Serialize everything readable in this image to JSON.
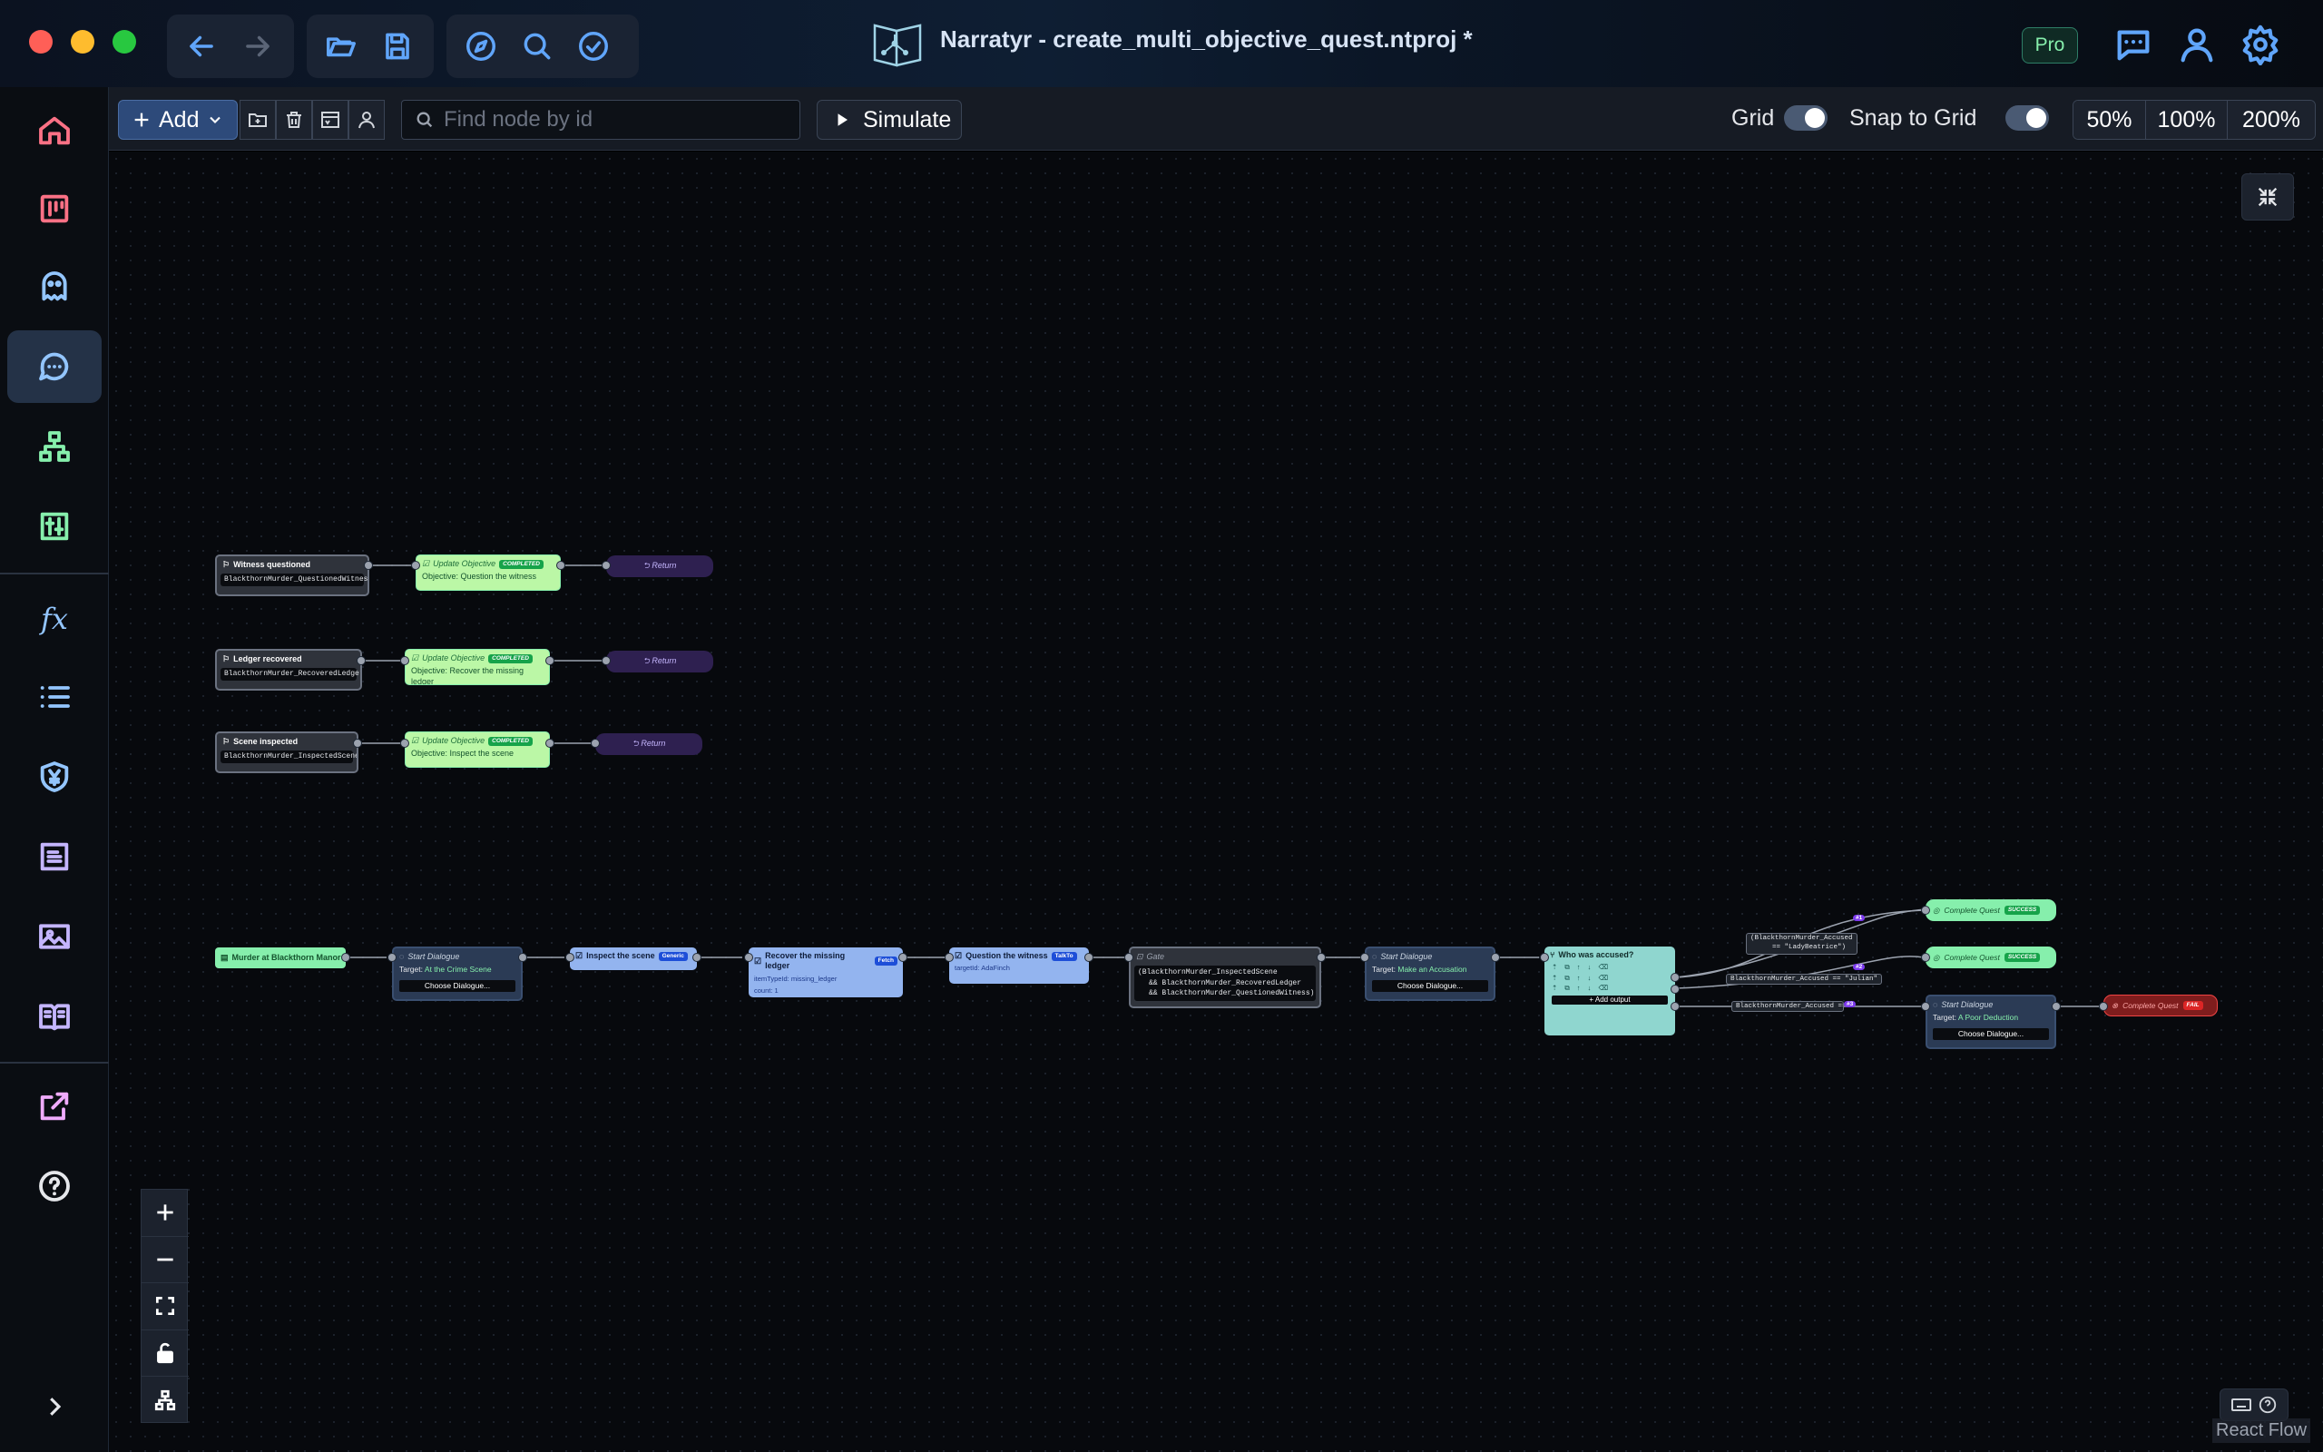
{
  "window": {
    "title": "Narratyr - create_multi_objective_quest.ntproj *",
    "pro_badge": "Pro"
  },
  "toolbar": {
    "add_label": "Add",
    "search_placeholder": "Find node by id",
    "simulate_label": "Simulate",
    "grid_label": "Grid",
    "snap_label": "Snap to Grid",
    "grid_on": true,
    "snap_on": true,
    "zoom_levels": [
      "50%",
      "100%",
      "200%"
    ]
  },
  "sidebar": {
    "items": [
      "home-icon",
      "board-icon",
      "ghost-icon",
      "chat-icon",
      "hierarchy-icon",
      "sliders-icon",
      "function-icon",
      "list-icon",
      "currency-icon",
      "document-icon",
      "image-icon",
      "book-icon",
      "export-icon",
      "help-icon"
    ],
    "fx_label": "fx"
  },
  "graph": {
    "flag_nodes": [
      {
        "title": "Witness questioned",
        "code": "BlackthornMurder_QuestionedWitness"
      },
      {
        "title": "Ledger recovered",
        "code": "BlackthornMurder_RecoveredLedger"
      },
      {
        "title": "Scene inspected",
        "code": "BlackthornMurder_InspectedScene"
      }
    ],
    "update_nodes": [
      {
        "title": "Update Objective",
        "badge": "COMPLETED",
        "body": "Objective: Question the witness"
      },
      {
        "title": "Update Objective",
        "badge": "COMPLETED",
        "body": "Objective: Recover the missing ledger"
      },
      {
        "title": "Update Objective",
        "badge": "COMPLETED",
        "body": "Objective: Inspect the scene"
      }
    ],
    "return_label": "Return",
    "entry": "Murder at Blackthorn Manor",
    "dialogue1": {
      "title": "Start Dialogue",
      "target_label": "Target:",
      "target": "At the Crime Scene",
      "choose": "Choose Dialogue..."
    },
    "obj_inspect": {
      "title": "Inspect the scene",
      "badge": "Generic"
    },
    "obj_ledger": {
      "title": "Recover the missing ledger",
      "badge": "Fetch",
      "line1_label": "itemTypeId:",
      "line1": "missing_ledger",
      "line2_label": "count:",
      "line2": "1"
    },
    "obj_witness": {
      "title": "Question the witness",
      "badge": "TalkTo",
      "line1_label": "targetId:",
      "line1": "AdaFinch"
    },
    "gate": {
      "title": "Gate",
      "lines": [
        "(BlackthornMurder_InspectedScene",
        "&& BlackthornMurder_RecoveredLedger",
        "&& BlackthornMurder_QuestionedWitness)"
      ]
    },
    "dialogue2": {
      "title": "Start Dialogue",
      "target_label": "Target:",
      "target": "Make an Accusation",
      "choose": "Choose Dialogue..."
    },
    "choice": {
      "title": "Who was accused?",
      "add_output": "+ Add output"
    },
    "conditions": [
      {
        "pill": "#1",
        "text": "(BlackthornMurder_Accused",
        "text2": "== \"LadyBeatrice\")"
      },
      {
        "pill": "#2",
        "text": "BlackthornMurder_Accused == \"Julian\""
      },
      {
        "pill": "#3",
        "text": "BlackthornMurder_Accused == \"A"
      }
    ],
    "complete_success": {
      "title": "Complete Quest",
      "badge": "SUCCESS"
    },
    "dialogue3": {
      "title": "Start Dialogue",
      "target_label": "Target:",
      "target": "A Poor Deduction",
      "choose": "Choose Dialogue..."
    },
    "complete_fail": {
      "title": "Complete Quest",
      "badge": "FAIL"
    }
  },
  "footer": {
    "attribution": "React Flow"
  }
}
